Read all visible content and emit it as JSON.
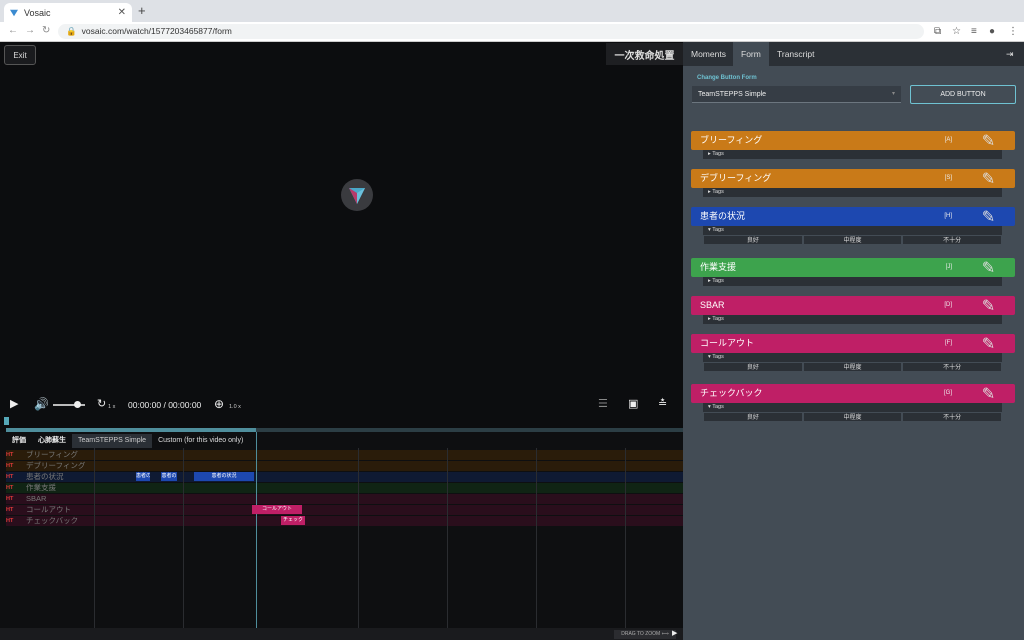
{
  "browser": {
    "tab_title": "Vosaic",
    "tab_close": "✕",
    "new_tab": "+",
    "url": "vosaic.com/watch/1577203465877/form",
    "back": "←",
    "forward": "→",
    "reload": "↻"
  },
  "video": {
    "exit_label": "Exit",
    "title": "一次救命処置",
    "time_current": "00:00:00",
    "time_total": "/ 00:00:00",
    "speed": "1 x",
    "zoom": "1.0 x"
  },
  "timeline": {
    "tabs": [
      "評価",
      "心肺蘇生",
      "TeamSTEPPS Simple",
      "Custom (for this video only)"
    ],
    "ht_label": "HT",
    "rows": [
      "ブリーフィング",
      "デブリーフィング",
      "患者の状況",
      "作業支援",
      "SBAR",
      "コールアウト",
      "チェックバック"
    ],
    "events": {
      "a": "患者の",
      "b": "患者の",
      "c": "患者の状況",
      "d": "コールアウト",
      "e": "チェック"
    },
    "drag_to_zoom": "DRAG TO ZOOM ⟺"
  },
  "panel": {
    "tabs": [
      "Moments",
      "Form",
      "Transcript"
    ],
    "change_button_form": "Change Button Form",
    "form_select": "TeamSTEPPS Simple",
    "add_button": "ADD BUTTON",
    "tags_label": "Tags",
    "buttons": [
      {
        "label": "ブリーフィング",
        "key": "[A]",
        "color": "#c97a18"
      },
      {
        "label": "デブリーフィング",
        "key": "[S]",
        "color": "#c97a18"
      },
      {
        "label": "患者の状況",
        "key": "[H]",
        "color": "#1d48b0"
      },
      {
        "label": "作業支援",
        "key": "[J]",
        "color": "#3da34d"
      },
      {
        "label": "SBAR",
        "key": "[D]",
        "color": "#bf1f66"
      },
      {
        "label": "コールアウト",
        "key": "[F]",
        "color": "#bf1f66"
      },
      {
        "label": "チェックバック",
        "key": "[G]",
        "color": "#bf1f66"
      }
    ],
    "tag_values": [
      "良好",
      "中程度",
      "不十分"
    ]
  },
  "colors": {
    "accent": "#6fc2d2",
    "orange": "#c97a18",
    "blue": "#1d48b0",
    "green": "#3da34d",
    "pink": "#bf1f66"
  }
}
